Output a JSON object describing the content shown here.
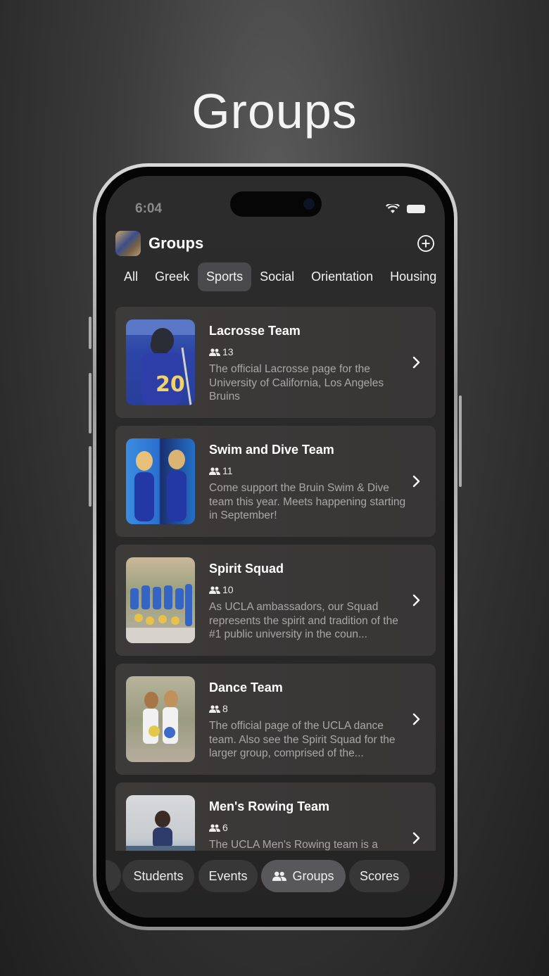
{
  "hero": {
    "title": "Groups"
  },
  "status_bar": {
    "time": "6:04"
  },
  "app": {
    "title": "Groups"
  },
  "filters": [
    {
      "label": "All",
      "active": false
    },
    {
      "label": "Greek",
      "active": false
    },
    {
      "label": "Sports",
      "active": true
    },
    {
      "label": "Social",
      "active": false
    },
    {
      "label": "Orientation",
      "active": false
    },
    {
      "label": "Housing",
      "active": false
    }
  ],
  "groups": [
    {
      "name": "Lacrosse Team",
      "members": "13",
      "description": "The official Lacrosse page for the University of California, Los Angeles Bruins"
    },
    {
      "name": "Swim and Dive Team",
      "members": "11",
      "description": "Come support the Bruin Swim & Dive team this year. Meets happening starting in September!"
    },
    {
      "name": "Spirit Squad",
      "members": "10",
      "description": "As UCLA ambassadors, our Squad represents the spirit and tradition of the #1 public university in the coun..."
    },
    {
      "name": "Dance Team",
      "members": "8",
      "description": "The official page of the UCLA dance team. Also see the Spirit Squad for the larger group, comprised of the..."
    },
    {
      "name": "Men's Rowing Team",
      "members": "6",
      "description": "The UCLA Men's Rowing team is a"
    }
  ],
  "tabbar": [
    {
      "label": "Students",
      "active": false
    },
    {
      "label": "Events",
      "active": false
    },
    {
      "label": "Groups",
      "active": true,
      "icon": "people-icon"
    },
    {
      "label": "Scores",
      "active": false
    }
  ],
  "colors": {
    "card_bg": "#3b3838",
    "active_pill": "#58585a",
    "desc_text": "#a9a7a7"
  }
}
